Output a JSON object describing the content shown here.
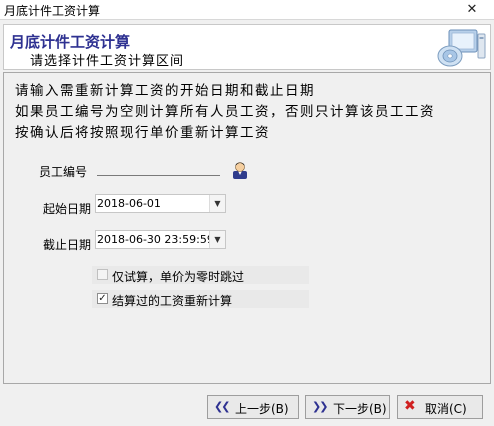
{
  "window": {
    "title": "月底计件工资计算",
    "close_glyph": "✕"
  },
  "header": {
    "title": "月底计件工资计算",
    "subtitle": "请选择计件工资计算区间"
  },
  "description": {
    "lines": [
      "请输入需重新计算工资的开始日期和截止日期",
      "如果员工编号为空则计算所有人员工资，否则只计算该员工工资",
      "按确认后将按照现行单价重新计算工资"
    ]
  },
  "form": {
    "employee_label": "员工编号",
    "employee_value": "",
    "start_label": "起始日期",
    "start_value": "2018-06-01",
    "end_label": "截止日期",
    "end_value": "2018-06-30 23:59:59",
    "trial_label": "仅试算，单价为零时跳过",
    "trial_checked": false,
    "recalc_label": "结算过的工资重新计算",
    "recalc_checked": true
  },
  "buttons": {
    "prev": "上一步(B)",
    "next": "下一步(B)",
    "cancel": "取消(C)"
  },
  "colors": {
    "title_blue": "#2e3191",
    "cancel_red": "#d02020"
  }
}
